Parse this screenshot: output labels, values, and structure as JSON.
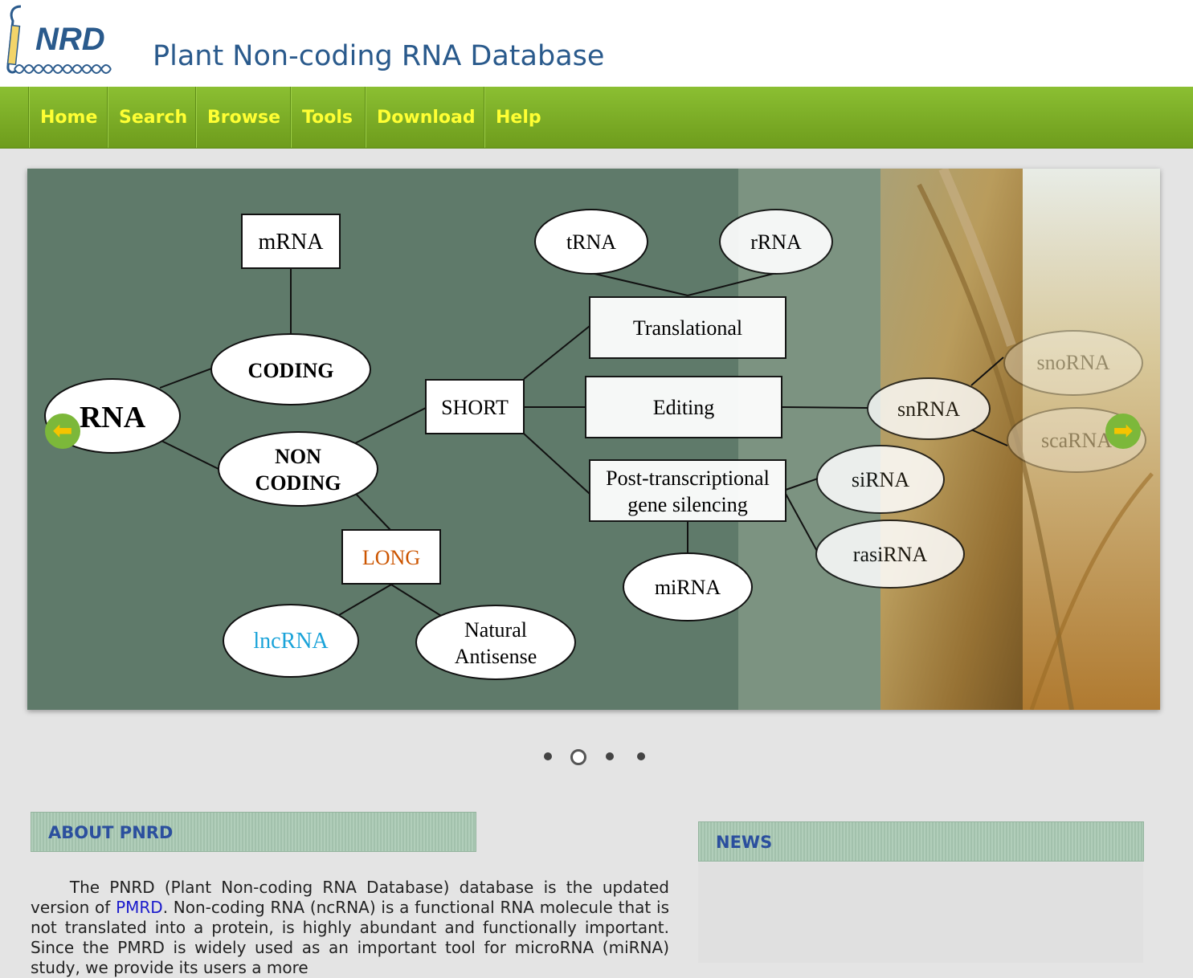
{
  "header": {
    "logo_text": "NRD",
    "title": "Plant Non-coding RNA Database"
  },
  "nav": {
    "items": [
      {
        "label": "Home"
      },
      {
        "label": "Search"
      },
      {
        "label": "Browse"
      },
      {
        "label": "Tools"
      },
      {
        "label": "Download"
      },
      {
        "label": "Help"
      }
    ]
  },
  "slider": {
    "prev_icon": "arrow-left-icon",
    "next_icon": "arrow-right-icon",
    "slide_count": 4,
    "active_slide": 2,
    "diagram": {
      "nodes": {
        "mrna": "mRNA",
        "coding": "CODING",
        "rna": "RNA",
        "non": "NON",
        "coding2": "CODING",
        "short": "SHORT",
        "long": "LONG",
        "lncrna": "lncRNA",
        "natural": "Natural",
        "antisense": "Antisense",
        "trna": "tRNA",
        "rrna": "rRNA",
        "translational": "Translational",
        "editing": "Editing",
        "ptgs1": "Post-transcriptional",
        "ptgs2": "gene silencing",
        "mirna": "miRNA",
        "snrna": "snRNA",
        "snorna": "snoRNA",
        "scarna": "scaRNA",
        "sirna": "siRNA",
        "rasirna": "rasiRNA"
      },
      "colors": {
        "background": "#5f7a6a",
        "long": "#cc5500",
        "lncrna": "#1aa3d9"
      }
    }
  },
  "about": {
    "heading": "ABOUT PNRD",
    "text_before_link": "The PNRD (Plant Non-coding RNA Database) database is the updated version of ",
    "link": "PMRD",
    "text_after_link": ". Non-coding RNA (ncRNA) is a functional RNA molecule that is not translated into a protein, is highly abundant and functionally important. Since the PMRD is widely used as an important tool for microRNA (miRNA) study, we provide its users a more"
  },
  "news": {
    "heading": "NEWS"
  }
}
